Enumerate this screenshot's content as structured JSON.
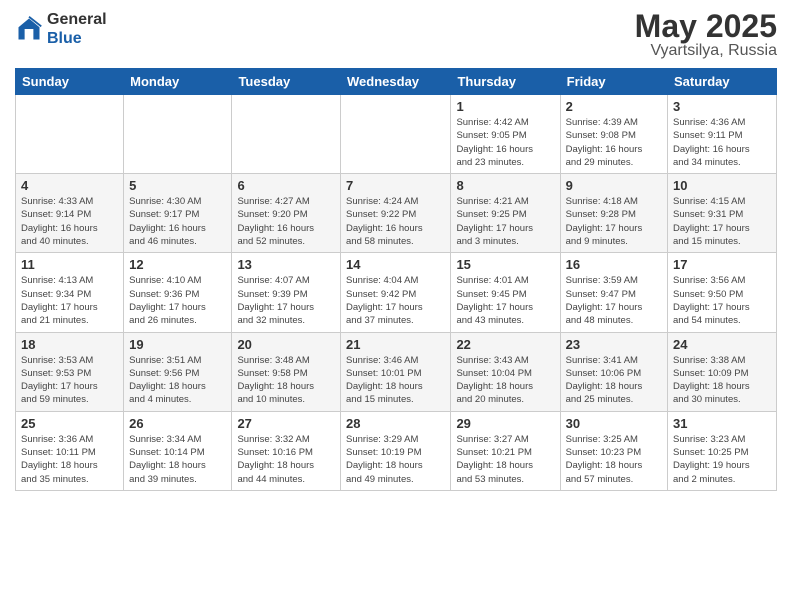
{
  "logo": {
    "general": "General",
    "blue": "Blue"
  },
  "title": {
    "month": "May 2025",
    "location": "Vyartsilya, Russia"
  },
  "headers": [
    "Sunday",
    "Monday",
    "Tuesday",
    "Wednesday",
    "Thursday",
    "Friday",
    "Saturday"
  ],
  "weeks": [
    [
      {
        "day": "",
        "info": ""
      },
      {
        "day": "",
        "info": ""
      },
      {
        "day": "",
        "info": ""
      },
      {
        "day": "",
        "info": ""
      },
      {
        "day": "1",
        "info": "Sunrise: 4:42 AM\nSunset: 9:05 PM\nDaylight: 16 hours\nand 23 minutes."
      },
      {
        "day": "2",
        "info": "Sunrise: 4:39 AM\nSunset: 9:08 PM\nDaylight: 16 hours\nand 29 minutes."
      },
      {
        "day": "3",
        "info": "Sunrise: 4:36 AM\nSunset: 9:11 PM\nDaylight: 16 hours\nand 34 minutes."
      }
    ],
    [
      {
        "day": "4",
        "info": "Sunrise: 4:33 AM\nSunset: 9:14 PM\nDaylight: 16 hours\nand 40 minutes."
      },
      {
        "day": "5",
        "info": "Sunrise: 4:30 AM\nSunset: 9:17 PM\nDaylight: 16 hours\nand 46 minutes."
      },
      {
        "day": "6",
        "info": "Sunrise: 4:27 AM\nSunset: 9:20 PM\nDaylight: 16 hours\nand 52 minutes."
      },
      {
        "day": "7",
        "info": "Sunrise: 4:24 AM\nSunset: 9:22 PM\nDaylight: 16 hours\nand 58 minutes."
      },
      {
        "day": "8",
        "info": "Sunrise: 4:21 AM\nSunset: 9:25 PM\nDaylight: 17 hours\nand 3 minutes."
      },
      {
        "day": "9",
        "info": "Sunrise: 4:18 AM\nSunset: 9:28 PM\nDaylight: 17 hours\nand 9 minutes."
      },
      {
        "day": "10",
        "info": "Sunrise: 4:15 AM\nSunset: 9:31 PM\nDaylight: 17 hours\nand 15 minutes."
      }
    ],
    [
      {
        "day": "11",
        "info": "Sunrise: 4:13 AM\nSunset: 9:34 PM\nDaylight: 17 hours\nand 21 minutes."
      },
      {
        "day": "12",
        "info": "Sunrise: 4:10 AM\nSunset: 9:36 PM\nDaylight: 17 hours\nand 26 minutes."
      },
      {
        "day": "13",
        "info": "Sunrise: 4:07 AM\nSunset: 9:39 PM\nDaylight: 17 hours\nand 32 minutes."
      },
      {
        "day": "14",
        "info": "Sunrise: 4:04 AM\nSunset: 9:42 PM\nDaylight: 17 hours\nand 37 minutes."
      },
      {
        "day": "15",
        "info": "Sunrise: 4:01 AM\nSunset: 9:45 PM\nDaylight: 17 hours\nand 43 minutes."
      },
      {
        "day": "16",
        "info": "Sunrise: 3:59 AM\nSunset: 9:47 PM\nDaylight: 17 hours\nand 48 minutes."
      },
      {
        "day": "17",
        "info": "Sunrise: 3:56 AM\nSunset: 9:50 PM\nDaylight: 17 hours\nand 54 minutes."
      }
    ],
    [
      {
        "day": "18",
        "info": "Sunrise: 3:53 AM\nSunset: 9:53 PM\nDaylight: 17 hours\nand 59 minutes."
      },
      {
        "day": "19",
        "info": "Sunrise: 3:51 AM\nSunset: 9:56 PM\nDaylight: 18 hours\nand 4 minutes."
      },
      {
        "day": "20",
        "info": "Sunrise: 3:48 AM\nSunset: 9:58 PM\nDaylight: 18 hours\nand 10 minutes."
      },
      {
        "day": "21",
        "info": "Sunrise: 3:46 AM\nSunset: 10:01 PM\nDaylight: 18 hours\nand 15 minutes."
      },
      {
        "day": "22",
        "info": "Sunrise: 3:43 AM\nSunset: 10:04 PM\nDaylight: 18 hours\nand 20 minutes."
      },
      {
        "day": "23",
        "info": "Sunrise: 3:41 AM\nSunset: 10:06 PM\nDaylight: 18 hours\nand 25 minutes."
      },
      {
        "day": "24",
        "info": "Sunrise: 3:38 AM\nSunset: 10:09 PM\nDaylight: 18 hours\nand 30 minutes."
      }
    ],
    [
      {
        "day": "25",
        "info": "Sunrise: 3:36 AM\nSunset: 10:11 PM\nDaylight: 18 hours\nand 35 minutes."
      },
      {
        "day": "26",
        "info": "Sunrise: 3:34 AM\nSunset: 10:14 PM\nDaylight: 18 hours\nand 39 minutes."
      },
      {
        "day": "27",
        "info": "Sunrise: 3:32 AM\nSunset: 10:16 PM\nDaylight: 18 hours\nand 44 minutes."
      },
      {
        "day": "28",
        "info": "Sunrise: 3:29 AM\nSunset: 10:19 PM\nDaylight: 18 hours\nand 49 minutes."
      },
      {
        "day": "29",
        "info": "Sunrise: 3:27 AM\nSunset: 10:21 PM\nDaylight: 18 hours\nand 53 minutes."
      },
      {
        "day": "30",
        "info": "Sunrise: 3:25 AM\nSunset: 10:23 PM\nDaylight: 18 hours\nand 57 minutes."
      },
      {
        "day": "31",
        "info": "Sunrise: 3:23 AM\nSunset: 10:25 PM\nDaylight: 19 hours\nand 2 minutes."
      }
    ]
  ]
}
